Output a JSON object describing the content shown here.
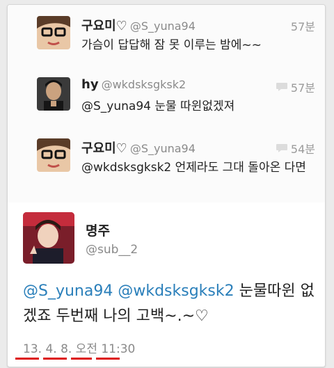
{
  "replies": [
    {
      "name": "구요미♡",
      "handle": "@S_yuna94",
      "time": "57분",
      "text": "가슴이 답답해 잠 못 이루는 밤에~~",
      "show_reply_icon": false
    },
    {
      "name": "hy",
      "handle": "@wkdsksgksk2",
      "time": "57분",
      "text": "@S_yuna94 눈물 따윈없겠져",
      "show_reply_icon": true
    },
    {
      "name": "구요미♡",
      "handle": "@S_yuna94",
      "time": "54분",
      "text": "@wkdsksgksk2 언제라도 그대 돌아온 다면",
      "show_reply_icon": true
    }
  ],
  "main_tweet": {
    "name": "명주",
    "handle": "@sub__2",
    "mention1": "@S_yuna94",
    "mention2": "@wkdsksgksk2",
    "text": "눈물따윈 없겠죠 두번째 나의 고백~.~♡",
    "timestamp": "13. 4. 8. 오전 11:30"
  },
  "colors": {
    "mention": "#2a7fba",
    "underline": "#dd1111"
  }
}
